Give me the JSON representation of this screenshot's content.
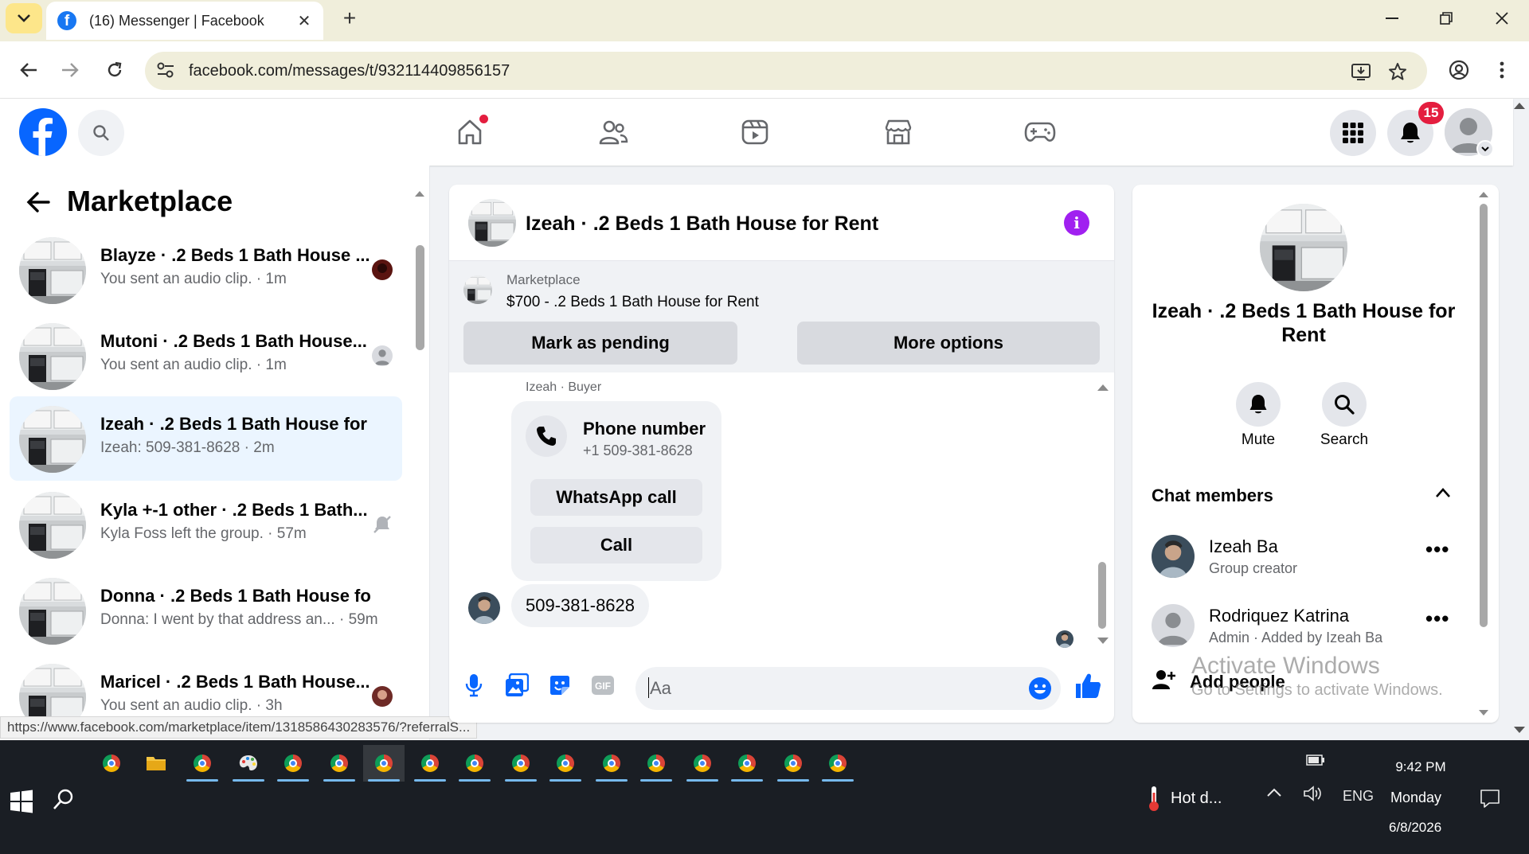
{
  "browser": {
    "tab_title": "(16) Messenger | Facebook",
    "new_tab": "+",
    "url": "facebook.com/messages/t/932114409856157",
    "status_url": "https://www.facebook.com/marketplace/item/1318586430283576/?referralS..."
  },
  "header": {
    "notifications_count": "15",
    "accent_color": "#0866ff",
    "badge_color": "#e41e3f"
  },
  "sidebar": {
    "title": "Marketplace",
    "chats": [
      {
        "name": "Blayze · .2 Beds 1 Bath House ...",
        "preview": "You sent an audio clip.",
        "time": "1m"
      },
      {
        "name": "Mutoni · .2 Beds 1 Bath House...",
        "preview": "You sent an audio clip.",
        "time": "1m"
      },
      {
        "name": "Izeah · .2 Beds 1 Bath House for ...",
        "preview": "Izeah: 509-381-8628",
        "time": "2m"
      },
      {
        "name": "Kyla +-1 other · .2 Beds 1 Bath...",
        "preview": "Kyla Foss left the group.",
        "time": "57m"
      },
      {
        "name": "Donna · .2 Beds 1 Bath House fo...",
        "preview": "Donna: I went by that address an...",
        "time": "59m"
      },
      {
        "name": "Maricel · .2 Beds 1 Bath House...",
        "preview": "You sent an audio clip.",
        "time": "3h"
      }
    ]
  },
  "conversation": {
    "title": "Izeah · .2 Beds 1 Bath House for Rent",
    "marketplace_label": "Marketplace",
    "listing": "$700 - .2 Beds 1 Bath House for Rent",
    "mark_pending": "Mark as pending",
    "more_options": "More options",
    "sender_meta": "Izeah · Buyer",
    "card_title": "Phone number",
    "card_phone": "+1 509-381-8628",
    "whatsapp_call": "WhatsApp call",
    "call": "Call",
    "message_text": "509-381-8628",
    "composer_placeholder": "Aa"
  },
  "info_panel": {
    "name": "Izeah · .2 Beds 1 Bath House for Rent",
    "mute_label": "Mute",
    "search_label": "Search",
    "section_title": "Chat members",
    "members": [
      {
        "name": "Izeah Ba",
        "role": "Group creator"
      },
      {
        "name": "Rodriquez Katrina",
        "role": "Admin · Added by Izeah Ba"
      }
    ],
    "add_people": "Add people"
  },
  "watermark": {
    "line1": "Activate Windows",
    "line2": "Go to Settings to activate Windows."
  },
  "taskbar": {
    "weather": "Hot d...",
    "lang": "ENG",
    "time": "9:42 PM",
    "day": "Monday",
    "date": "6/8/2026"
  }
}
